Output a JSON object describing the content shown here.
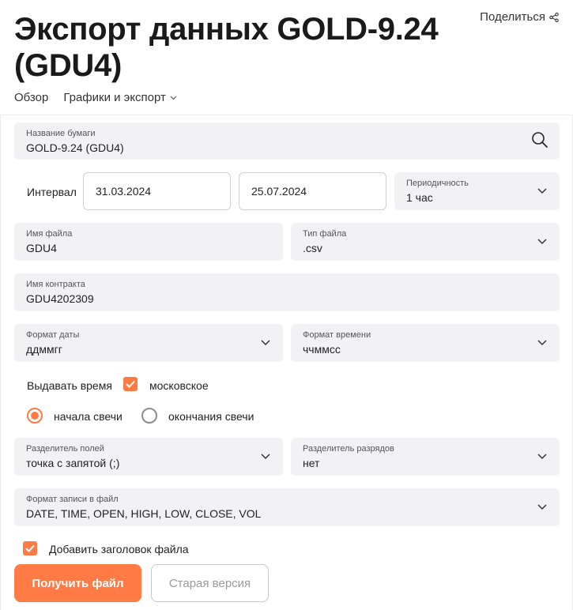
{
  "header": {
    "title": "Экспорт данных GOLD-9.24 (GDU4)",
    "share_label": "Поделиться"
  },
  "nav": {
    "tabs": [
      {
        "label": "Обзор"
      },
      {
        "label": "Графики и экспорт"
      }
    ]
  },
  "form": {
    "security": {
      "label": "Название бумаги",
      "value": "GOLD-9.24 (GDU4)"
    },
    "interval": {
      "label": "Интервал",
      "from": "31.03.2024",
      "to": "25.07.2024"
    },
    "periodicity": {
      "label": "Периодичность",
      "value": "1 час"
    },
    "file_name": {
      "label": "Имя файла",
      "value": "GDU4"
    },
    "file_type": {
      "label": "Тип файла",
      "value": ".csv"
    },
    "contract_name": {
      "label": "Имя контракта",
      "value": "GDU4202309"
    },
    "date_format": {
      "label": "Формат даты",
      "value": "ддммгг"
    },
    "time_format": {
      "label": "Формат времени",
      "value": "ччммсс"
    },
    "time_output": {
      "label": "Выдавать время",
      "checkbox_label": "московское",
      "checked": true
    },
    "candle_time": {
      "options": [
        {
          "label": "начала свечи",
          "selected": true
        },
        {
          "label": "окончания свечи",
          "selected": false
        }
      ]
    },
    "field_separator": {
      "label": "Разделитель полей",
      "value": "точка с запятой (;)"
    },
    "digit_separator": {
      "label": "Разделитель разрядов",
      "value": "нет"
    },
    "record_format": {
      "label": "Формат записи в файл",
      "value": "DATE, TIME, OPEN, HIGH, LOW, CLOSE, VOL"
    },
    "add_header": {
      "label": "Добавить заголовок файла",
      "checked": true
    }
  },
  "actions": {
    "get_file": "Получить файл",
    "old_version": "Старая версия"
  },
  "colors": {
    "accent": "#ff7a45",
    "field_bg": "#f2f2f4"
  }
}
